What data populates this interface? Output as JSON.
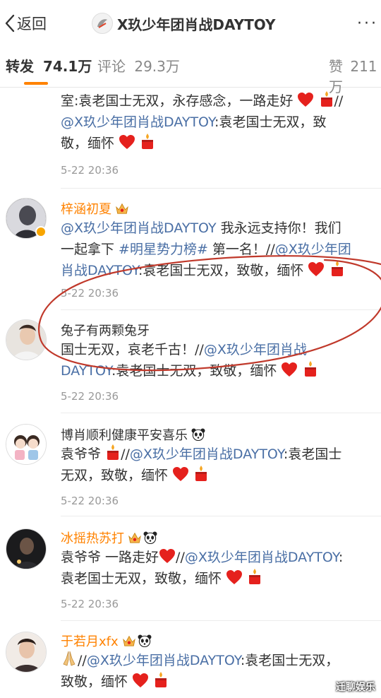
{
  "header": {
    "back_label": "返回",
    "title": "X玖少年团肖战DAYTOY",
    "more": "···"
  },
  "tabs": {
    "repost_label": "转发",
    "repost_count": "74.1万",
    "comment_label": "评论",
    "comment_count": "29.3万",
    "like_label": "赞",
    "like_count": "211万"
  },
  "partial": {
    "line1": "室:袁老国士无双，永存感念，一路走好",
    "mention": "@X玖少年团肖战DAYTOY",
    "line2b": ":袁老国士无双，致",
    "line3": "敬，缅怀",
    "time": "5-22 20:36"
  },
  "items": [
    {
      "name": "梓涵初夏",
      "mention1": "@X玖少年团肖战DAYTOY",
      "t1": " 我永远支持你！我们",
      "t2a": "一起拿下 ",
      "hashtag": "#明星势力榜#",
      "t2b": " 第一名！//",
      "mention2a": "@X玖少年团",
      "mention2b": "肖战DAYTOY",
      "t3": ":袁老国士无双，致敬，缅怀",
      "time": "5-22 20:36"
    },
    {
      "name": "兔子有两颗兔牙",
      "t1": "国士无双，哀老千古！//",
      "mention_a": "@X玖少年团肖战",
      "mention_b": "DAYTOY",
      "t2": ":袁老国士无双，致敬，缅怀",
      "time": "5-22 20:36"
    },
    {
      "name": "博肖顺利健康平安喜乐",
      "t1a": "袁爷爷",
      "t1b": "//",
      "mention": "@X玖少年团肖战DAYTOY",
      "t1c": ":袁老国士",
      "t2": "无双，致敬，缅怀",
      "time": "5-22 20:36"
    },
    {
      "name": "冰摇热苏打",
      "t1a": "袁爷爷 一路走好",
      "t1b": "//",
      "mention": "@X玖少年团肖战DAYTOY",
      "t1c": ":",
      "t2": "袁老国士无双，致敬，缅怀",
      "time": "5-22 20:36"
    },
    {
      "name": "于若月xfx",
      "t1b": "//",
      "mention": "@X玖少年团肖战DAYTOY",
      "t1c": ":袁老国士无双，",
      "t2": "致敬，缅怀"
    }
  ],
  "watermark": "迁聊娱乐",
  "icons": {
    "heart": "red-heart-icon",
    "candle": "candle-icon",
    "badge": "crown-badge-icon",
    "panda": "panda-icon",
    "pray": "praying-hands-icon"
  },
  "colors": {
    "accent": "#ff8200",
    "link": "#4a6fa5",
    "circle": "#c0392b"
  }
}
